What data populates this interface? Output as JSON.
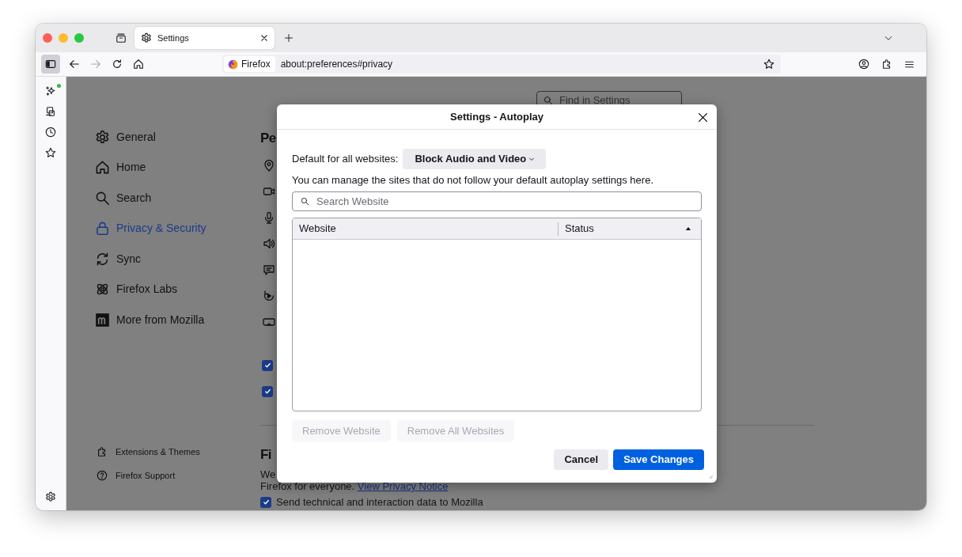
{
  "tabs": [
    {
      "label": "Settings",
      "selected": true
    }
  ],
  "address_bar": {
    "identity": "Firefox",
    "url": "about:preferences#privacy"
  },
  "settings_nav": {
    "items": [
      {
        "label": "General",
        "selected": false
      },
      {
        "label": "Home",
        "selected": false
      },
      {
        "label": "Search",
        "selected": false
      },
      {
        "label": "Privacy & Security",
        "selected": true
      },
      {
        "label": "Sync",
        "selected": false
      },
      {
        "label": "Firefox Labs",
        "selected": false
      },
      {
        "label": "More from Mozilla",
        "selected": false
      }
    ],
    "footer_links": [
      "Extensions & Themes",
      "Firefox Support"
    ]
  },
  "settings_search": {
    "placeholder": "Find in Settings"
  },
  "content": {
    "heading_1": "Pe",
    "checkboxes": [
      {
        "checked": true
      },
      {
        "checked": true
      }
    ],
    "heading_2": "Fi",
    "text_start": "We",
    "text_line": "Firefox for everyone.",
    "link": "View Privacy Notice",
    "data_checkbox": {
      "label": "Send technical and interaction data to Mozilla",
      "checked": true
    }
  },
  "dialog": {
    "title": "Settings - Autoplay",
    "default_label": "Default for all websites:",
    "default_value": "Block Audio and Video",
    "description": "You can manage the sites that do not follow your default autoplay settings here.",
    "search": {
      "placeholder": "Search Website"
    },
    "table": {
      "columns": [
        {
          "label": "Website",
          "sorted": false
        },
        {
          "label": "Status",
          "sorted": true
        }
      ]
    },
    "list_buttons": [
      {
        "label": "Remove Website",
        "disabled": true
      },
      {
        "label": "Remove All Websites",
        "disabled": true
      }
    ],
    "footer_buttons": [
      {
        "label": "Cancel",
        "kind": "secondary"
      },
      {
        "label": "Save Changes",
        "kind": "primary"
      }
    ]
  }
}
